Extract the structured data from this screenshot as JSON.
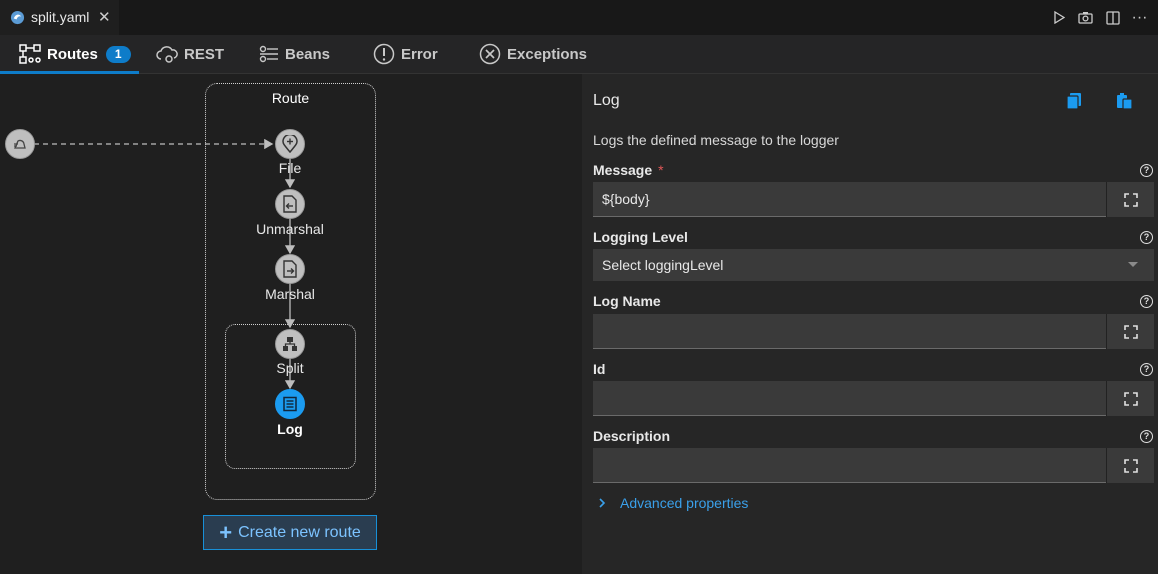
{
  "editor": {
    "file_tab": "split.yaml",
    "close_glyph": "✕",
    "actions": [
      "play-icon",
      "camera-icon",
      "split-editor-icon",
      "more-icon"
    ],
    "more_glyph": "···"
  },
  "nav": {
    "routes": "Routes",
    "routes_count": "1",
    "rest": "REST",
    "beans": "Beans",
    "error": "Error",
    "exceptions": "Exceptions"
  },
  "canvas": {
    "route_title": "Route",
    "nodes": {
      "file": "File",
      "unmarshal": "Unmarshal",
      "marshal": "Marshal",
      "split": "Split",
      "log": "Log"
    },
    "create_route": "Create new route",
    "selected_color": "#1b9bf0"
  },
  "panel": {
    "title": "Log",
    "description": "Logs the defined message to the logger",
    "fields": {
      "message_label": "Message",
      "message_required": "*",
      "message_value": "${body}",
      "logging_level_label": "Logging Level",
      "logging_level_placeholder": "Select loggingLevel",
      "log_name_label": "Log Name",
      "log_name_value": "",
      "id_label": "Id",
      "id_value": "",
      "description_label": "Description",
      "description_value": ""
    },
    "help_glyph": "?",
    "advanced": "Advanced properties",
    "accent_color": "#0e7cc9"
  }
}
